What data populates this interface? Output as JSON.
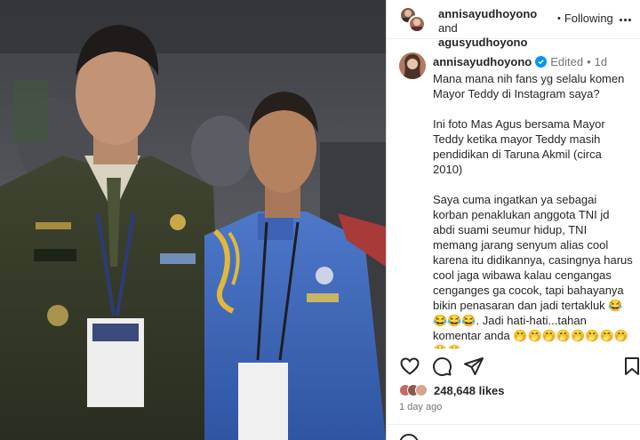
{
  "header": {
    "user1": "annisayudhoyono",
    "and_text": " and",
    "user2": "agusyudhoyono",
    "dot": "•",
    "following": "Following"
  },
  "caption": {
    "username": "annisayudhoyono",
    "edited": "Edited",
    "dot": "•",
    "age": "1d",
    "text": "Mana mana nih fans yg selalu komen Mayor Teddy di Instagram saya?\n\nIni foto Mas Agus bersama Mayor Teddy ketika mayor Teddy masih pendidikan di Taruna Akmil (circa 2010)\n\nSaya cuma ingatkan ya sebagai korban penaklukan anggota TNI jd abdi suami seumur hidup, TNI memang jarang senyum alias cool karena itu didikannya, casingnya harus cool jaga wibawa kalau cengangas cenganges ga cocok, tapi bahayanya bikin penasaran dan jadi tertakluk 😂😂😂😂. Jadi hati-hati...tahan komentar anda 🤭🤭🤭🤭🤭🤭🤭🤭\n🤭🤭\n(Tertanda istri pensiunan anggota TNI , Annisa Pohan)"
  },
  "likes": {
    "count": "248,648 likes"
  },
  "timestamp": "1 day ago",
  "icons": {
    "like": "heart-icon",
    "comment": "comment-icon",
    "share": "share-icon",
    "save": "bookmark-icon",
    "more": "more-icon",
    "verified": "verified-badge-icon"
  },
  "colors": {
    "verified": "#0095f6",
    "muted": "#737373",
    "text": "#262626"
  }
}
